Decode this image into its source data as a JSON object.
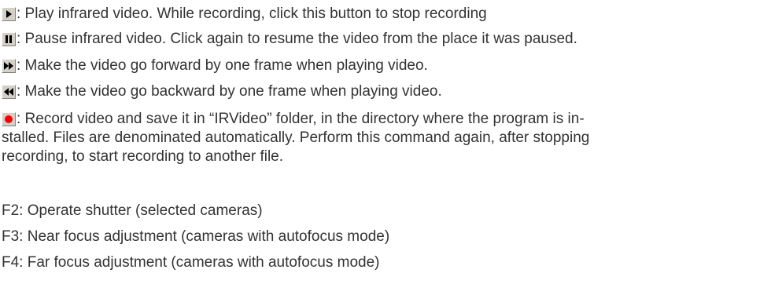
{
  "icons": {
    "play": "play-icon",
    "pause": "pause-icon",
    "forward": "step-forward-icon",
    "backward": "step-backward-icon",
    "record": "record-icon"
  },
  "colors": {
    "text": "#333333",
    "button_face": "#d4d0c8",
    "record_red": "#ff0000"
  },
  "items": {
    "play": " : Play infrared video. While recording, click this button to stop recording",
    "pause": ": Pause infrared video. Click again to resume the video from the place it was paused.",
    "forward": ": Make the video go forward by one frame when playing video.",
    "backward": ": Make the video go backward by one frame when playing video.",
    "record_line1": " : Record video and save it in “IRVideo” folder, in the directory where the program is in-",
    "record_line2": "stalled. Files are denominated automatically. Perform this command again, after stopping",
    "record_line3": "recording, to start recording to another file."
  },
  "shortcuts": [
    "F2: Operate shutter (selected cameras)",
    "F3: Near focus adjustment (cameras with autofocus mode)",
    "F4: Far focus adjustment (cameras with autofocus mode)"
  ]
}
